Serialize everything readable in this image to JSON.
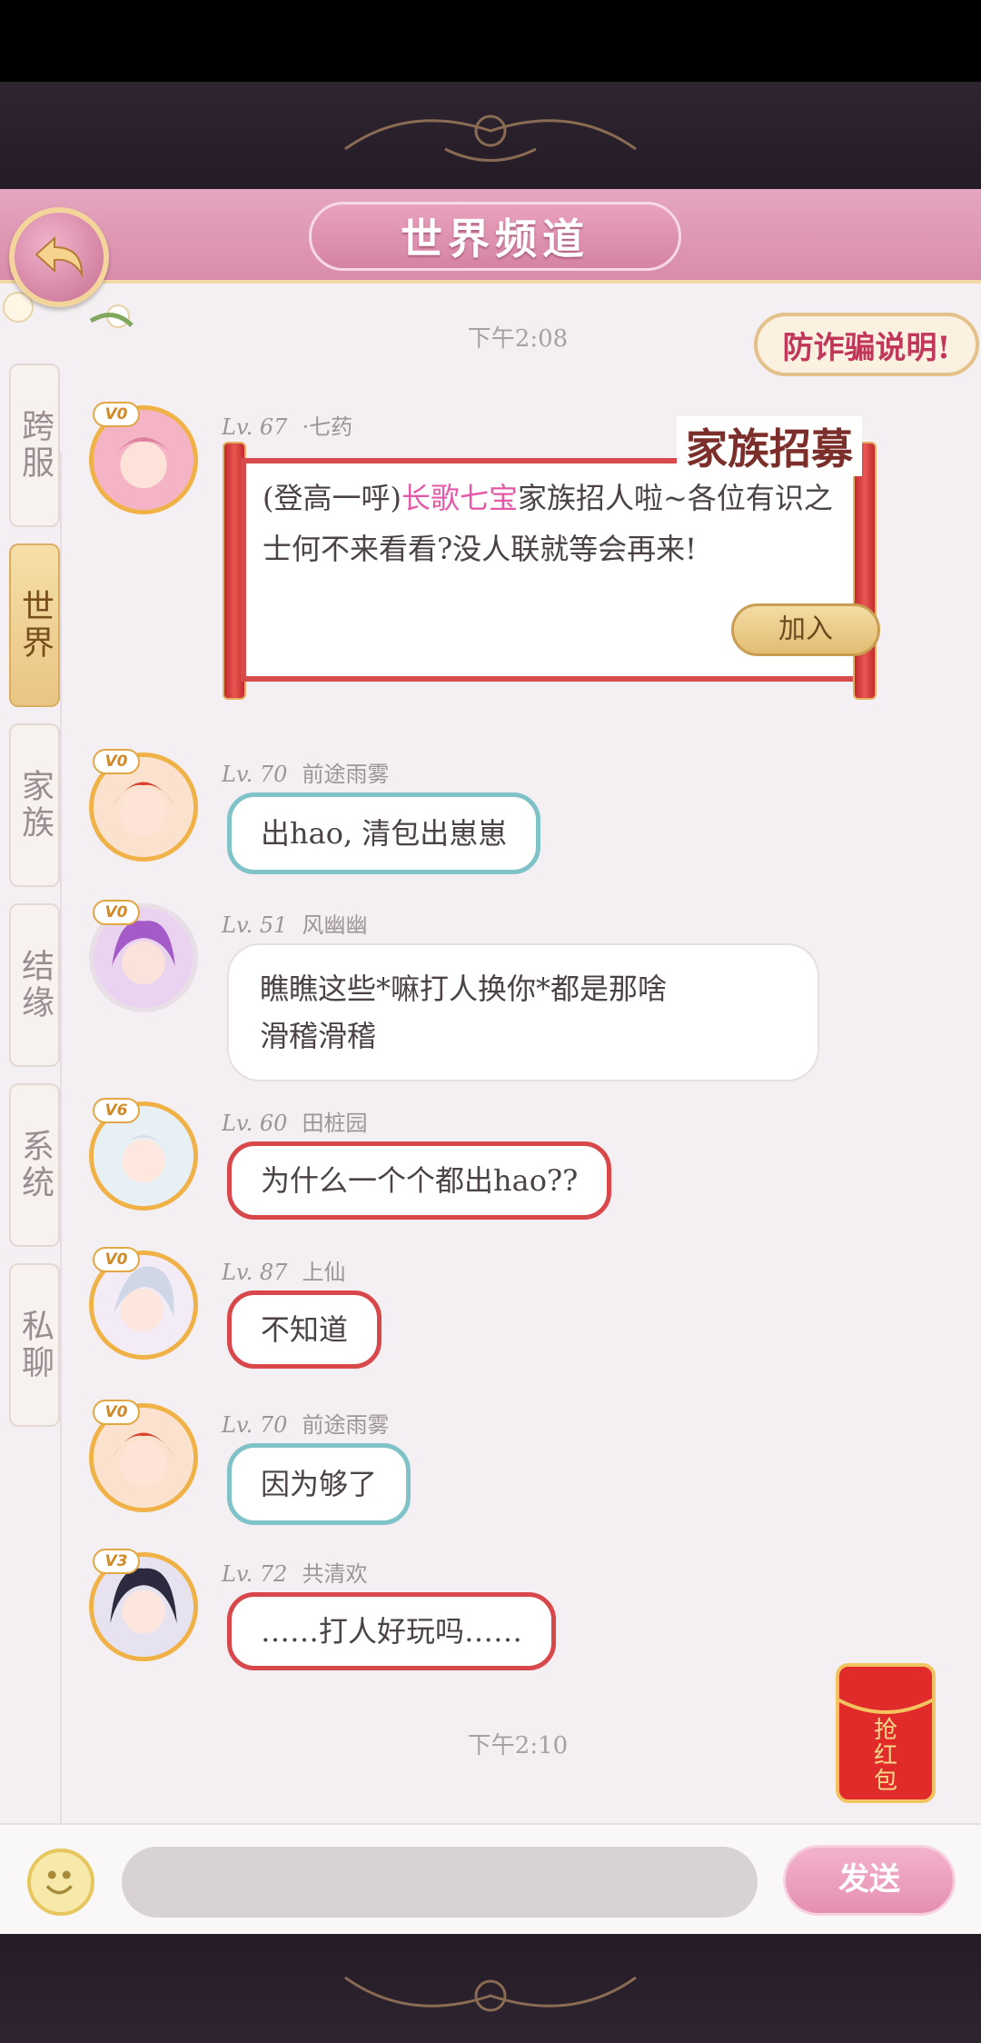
{
  "header": {
    "title": "世界频道",
    "anti_fraud_label": "防诈骗说明!"
  },
  "sidebar": {
    "tabs": [
      {
        "label": "跨服",
        "active": false
      },
      {
        "label": "世界",
        "active": true
      },
      {
        "label": "家族",
        "active": false
      },
      {
        "label": "结缘",
        "active": false
      },
      {
        "label": "系统",
        "active": false
      },
      {
        "label": "私聊",
        "active": false
      }
    ]
  },
  "timestamps": [
    "下午2:08",
    "下午2:10"
  ],
  "messages": [
    {
      "vip": "V0",
      "level": "Lv. 67",
      "name": "·七药",
      "recruit": {
        "title": "家族招募",
        "prefix": "(登高一呼)",
        "family": "长歌七宝",
        "text": "家族招人啦~各位有识之士何不来看看?没人联就等会再来!",
        "join_label": "加入"
      }
    },
    {
      "vip": "V0",
      "level": "Lv. 70",
      "name": "前途雨雾",
      "text": "出hao, 清包出崽崽",
      "style": "teal"
    },
    {
      "vip": "V0",
      "level": "Lv. 51",
      "name": "风幽幽",
      "text_lines": [
        "瞧瞧这些*嘛打人换你*都是那啥",
        "滑稽滑稽"
      ],
      "style": "white"
    },
    {
      "vip": "V6",
      "level": "Lv. 60",
      "name": "田桩园",
      "text": "为什么一个个都出hao??",
      "style": "red"
    },
    {
      "vip": "V0",
      "level": "Lv. 87",
      "name": "上仙",
      "text": "不知道",
      "style": "red"
    },
    {
      "vip": "V0",
      "level": "Lv. 70",
      "name": "前途雨雾",
      "text": "因为够了",
      "style": "teal"
    },
    {
      "vip": "V3",
      "level": "Lv. 72",
      "name": "共清欢",
      "text": "……打人好玩吗……",
      "style": "red"
    }
  ],
  "red_envelope": {
    "label": "抢红包"
  },
  "input": {
    "placeholder": "",
    "send_label": "发送"
  },
  "colors": {
    "accent_pink": "#d98cab",
    "gold": "#f2d9a6",
    "recruit_red": "#d84a4c",
    "highlight": "#e45aa8"
  }
}
